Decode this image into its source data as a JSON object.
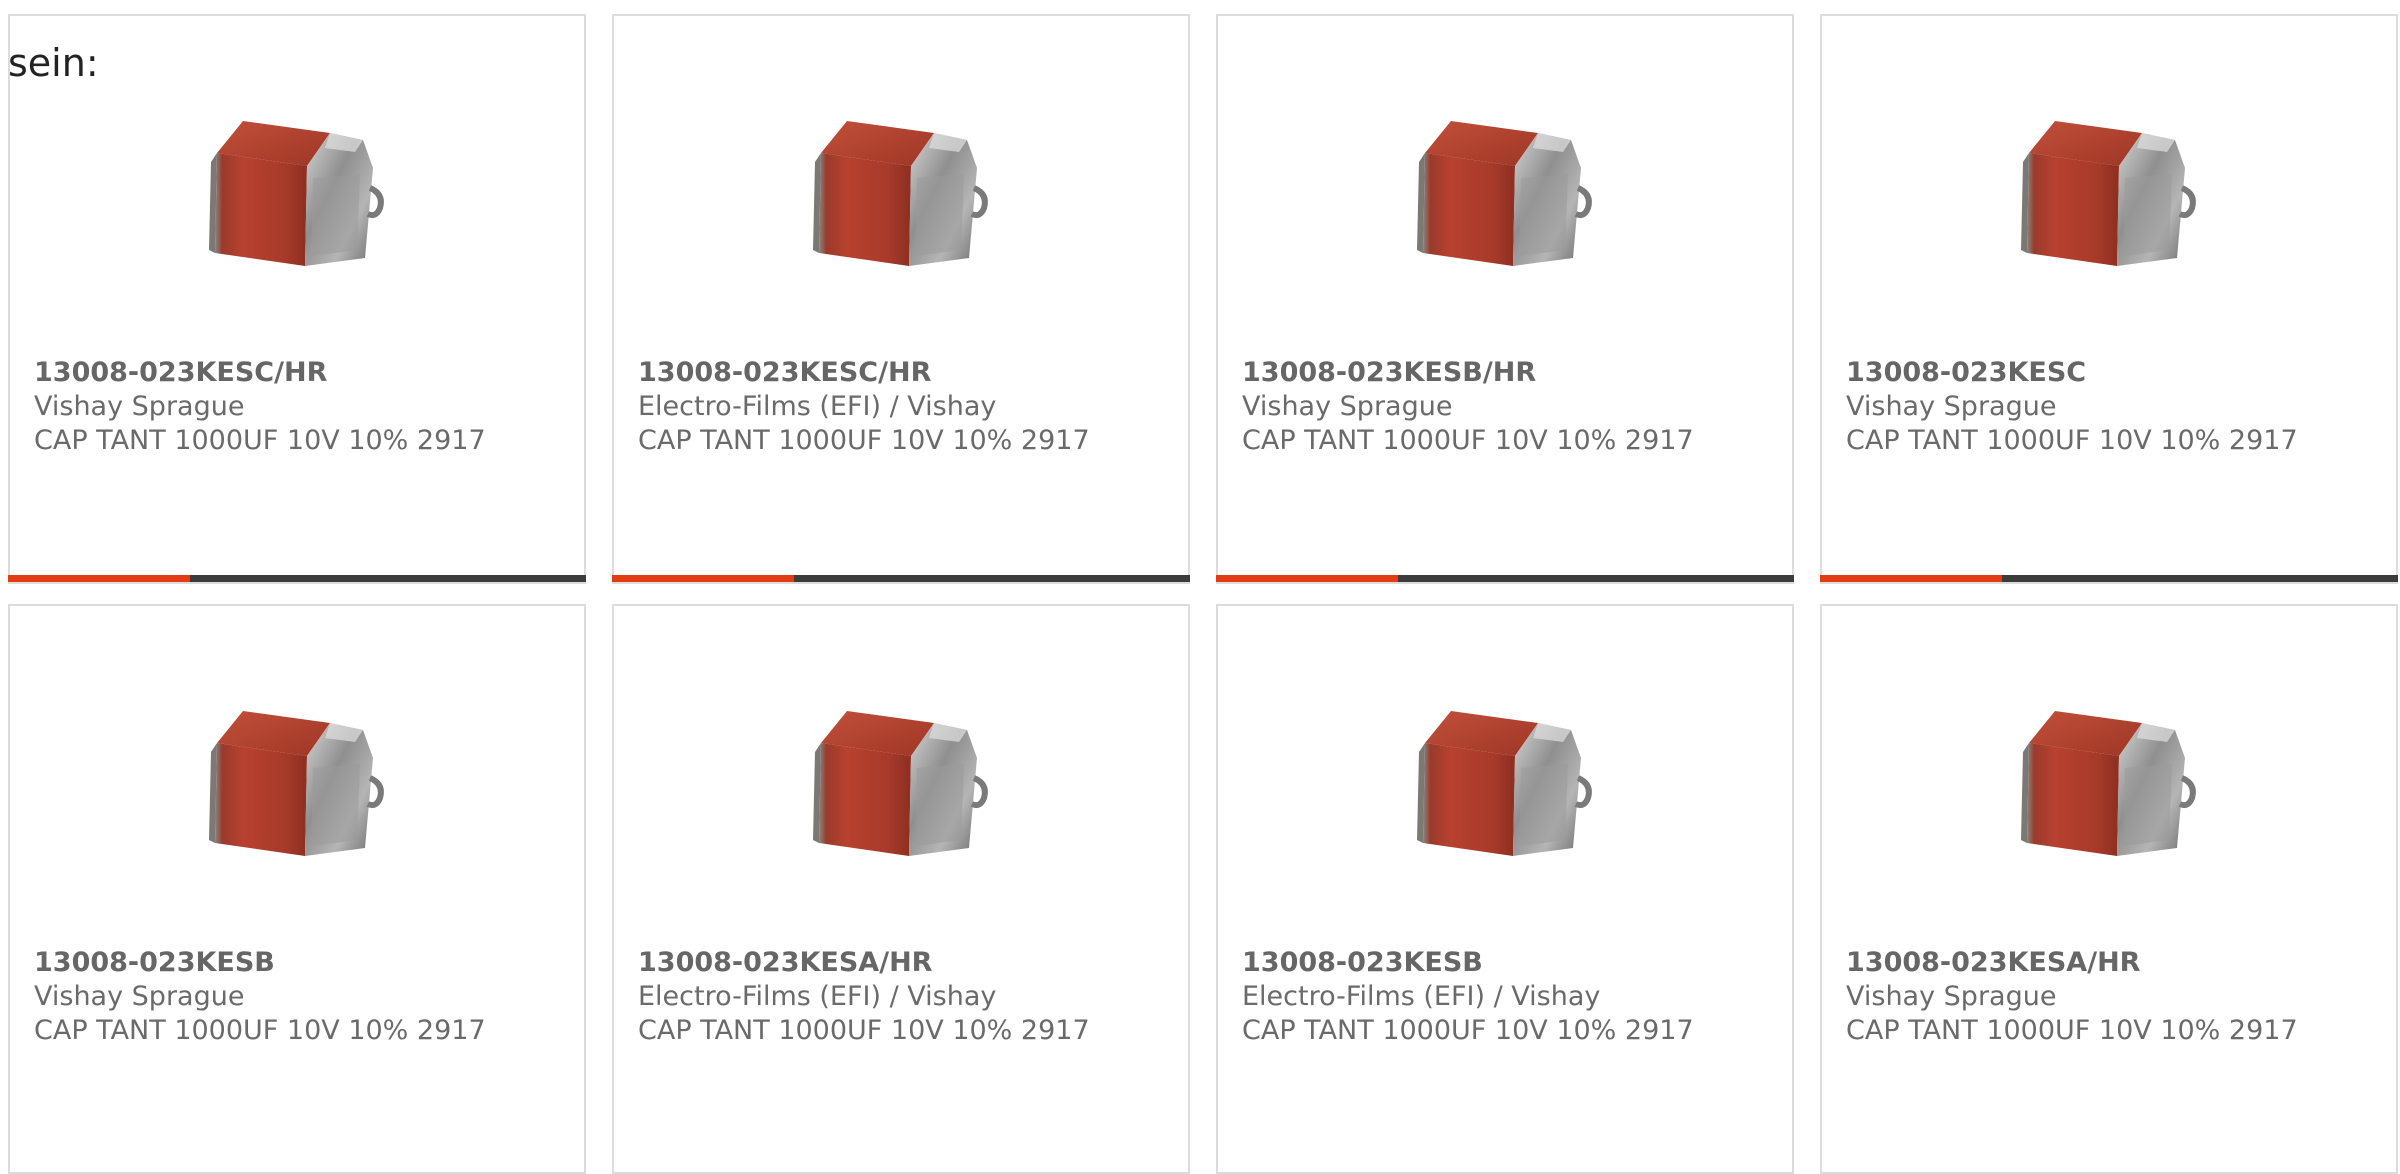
{
  "intro_text": "sein:",
  "colors": {
    "accent": "#e33b12",
    "bar_dark": "#3c3c3c",
    "card_border": "#dcdcdc",
    "text": "#6a6a6a"
  },
  "products": [
    {
      "part_number": "13008-023KESC/HR",
      "manufacturer": "Vishay Sprague",
      "description": "CAP TANT 1000UF 10V 10% 2917"
    },
    {
      "part_number": "13008-023KESC/HR",
      "manufacturer": "Electro-Films (EFI) / Vishay",
      "description": "CAP TANT 1000UF 10V 10% 2917"
    },
    {
      "part_number": "13008-023KESB/HR",
      "manufacturer": "Vishay Sprague",
      "description": "CAP TANT 1000UF 10V 10% 2917"
    },
    {
      "part_number": "13008-023KESC",
      "manufacturer": "Vishay Sprague",
      "description": "CAP TANT 1000UF 10V 10% 2917"
    },
    {
      "part_number": "13008-023KESB",
      "manufacturer": "Vishay Sprague",
      "description": "CAP TANT 1000UF 10V 10% 2917"
    },
    {
      "part_number": "13008-023KESA/HR",
      "manufacturer": "Electro-Films (EFI) / Vishay",
      "description": "CAP TANT 1000UF 10V 10% 2917"
    },
    {
      "part_number": "13008-023KESB",
      "manufacturer": "Electro-Films (EFI) / Vishay",
      "description": "CAP TANT 1000UF 10V 10% 2917"
    },
    {
      "part_number": "13008-023KESA/HR",
      "manufacturer": "Vishay Sprague",
      "description": "CAP TANT 1000UF 10V 10% 2917"
    }
  ]
}
